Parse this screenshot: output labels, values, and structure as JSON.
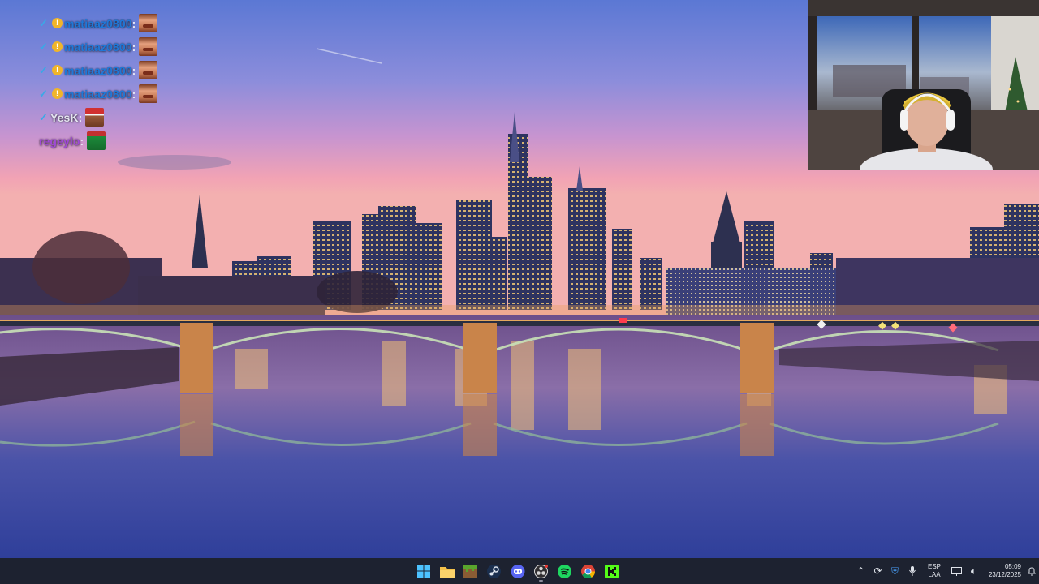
{
  "chat": {
    "messages": [
      {
        "user": "matiaaz0800",
        "badge": "gold-coin",
        "separator": ":",
        "user_color": "#1f78d8",
        "emote": "face"
      },
      {
        "user": "matiaaz0800",
        "badge": "gold-coin",
        "separator": ":",
        "user_color": "#1f78d8",
        "emote": "face"
      },
      {
        "user": "matiaaz0800",
        "badge": "gold-coin",
        "separator": ":",
        "user_color": "#1f78d8",
        "emote": "face"
      },
      {
        "user": "matiaaz0800",
        "badge": "gold-coin",
        "separator": ":",
        "user_color": "#1f78d8",
        "emote": "face"
      },
      {
        "user": "YesK",
        "badge": "",
        "separator": ":",
        "user_color": "#e4e4f0",
        "emote": "santa-hat"
      },
      {
        "user": "regeylo",
        "badge": "",
        "separator": ":",
        "user_color": "#a04ad6",
        "emote": "green"
      }
    ]
  },
  "taskbar": {
    "apps": [
      {
        "name": "start-button",
        "icon": "windows-logo-icon"
      },
      {
        "name": "file-explorer",
        "icon": "folder-icon"
      },
      {
        "name": "minecraft-launcher",
        "icon": "grass-block-icon"
      },
      {
        "name": "steam",
        "icon": "steam-icon"
      },
      {
        "name": "discord",
        "icon": "discord-icon"
      },
      {
        "name": "obs-studio",
        "icon": "obs-icon"
      },
      {
        "name": "spotify",
        "icon": "spotify-icon"
      },
      {
        "name": "chrome",
        "icon": "chrome-icon"
      },
      {
        "name": "kick",
        "icon": "kick-icon"
      }
    ],
    "tray": {
      "language_line1": "ESP",
      "language_line2": "LAA",
      "time": "05:09",
      "date": "23/12/2025"
    }
  },
  "colors": {
    "taskbar_bg": "#1d2230",
    "chat_check": "#39a9e6",
    "badge": "#f0b52a"
  }
}
